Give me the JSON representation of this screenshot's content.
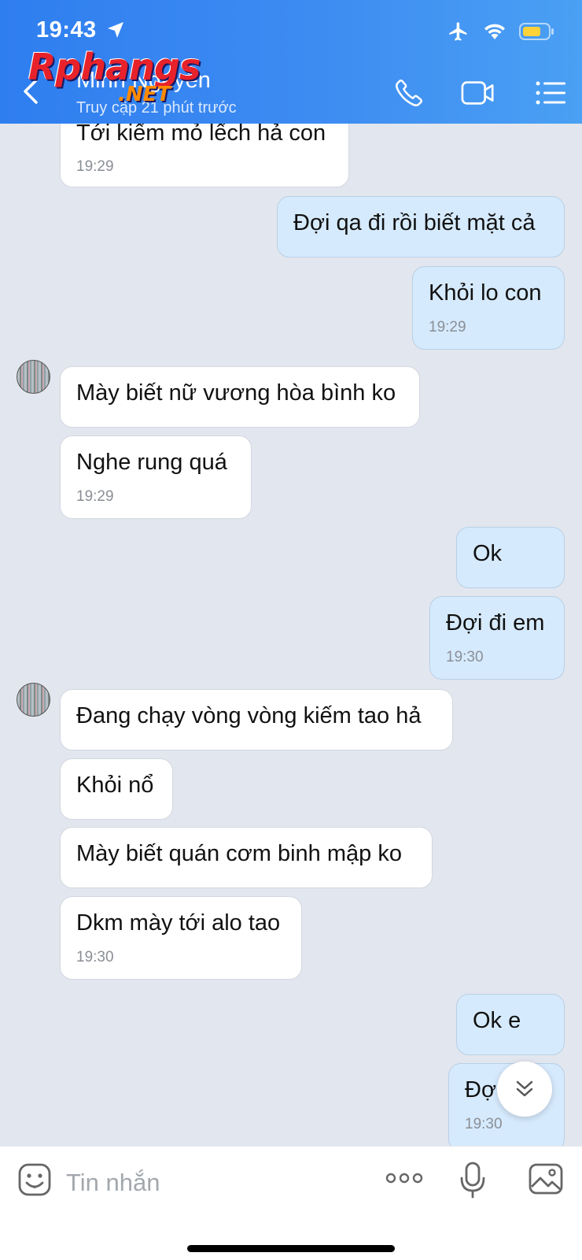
{
  "status_bar": {
    "time": "19:43"
  },
  "header": {
    "contact_name": "Minh Nguyễn",
    "contact_status": "Truy cập 21 phút trước",
    "watermark_main": "Rphangs",
    "watermark_suffix": ".NET"
  },
  "messages": [
    {
      "dir": "in",
      "text": "Tới kiếm mỏ lếch hả con",
      "time": "19:29"
    },
    {
      "dir": "out",
      "text": "Đợi qa đi rồi biết mặt cả",
      "time": ""
    },
    {
      "dir": "out",
      "text": "Khỏi lo con",
      "time": "19:29"
    },
    {
      "dir": "in",
      "text": "Mày biết nữ vương hòa bình ko",
      "time": "",
      "avatar": true
    },
    {
      "dir": "in",
      "text": "Nghe rung quá",
      "time": "19:29"
    },
    {
      "dir": "out",
      "text": "Ok",
      "time": ""
    },
    {
      "dir": "out",
      "text": "Đợi đi em",
      "time": "19:30"
    },
    {
      "dir": "in",
      "text": "Đang chạy vòng vòng kiếm tao hả",
      "time": "",
      "avatar": true
    },
    {
      "dir": "in",
      "text": "Khỏi nổ",
      "time": ""
    },
    {
      "dir": "in",
      "text": "Mày biết quán cơm binh mập ko",
      "time": ""
    },
    {
      "dir": "in",
      "text": "Dkm mày tới alo tao",
      "time": "19:30"
    },
    {
      "dir": "out",
      "text": "Ok e",
      "time": ""
    },
    {
      "dir": "out",
      "text": "Đợ",
      "time": "19:30"
    }
  ],
  "input": {
    "placeholder": "Tin nhắn"
  },
  "colors": {
    "header_gradient_start": "#2f7ef0",
    "header_gradient_end": "#4aa0f3",
    "incoming_bubble": "#ffffff",
    "outgoing_bubble": "#d6eafd",
    "chat_background": "#e2e6ee"
  },
  "icons": {
    "status": [
      "location-arrow-icon",
      "airplane-icon",
      "wifi-icon",
      "battery-icon"
    ],
    "header": [
      "back-chevron-icon",
      "phone-icon",
      "video-camera-icon",
      "menu-list-icon"
    ],
    "input": [
      "sticker-icon",
      "more-dots-icon",
      "microphone-icon",
      "image-icon"
    ],
    "floating": [
      "double-chevron-down-icon"
    ]
  }
}
